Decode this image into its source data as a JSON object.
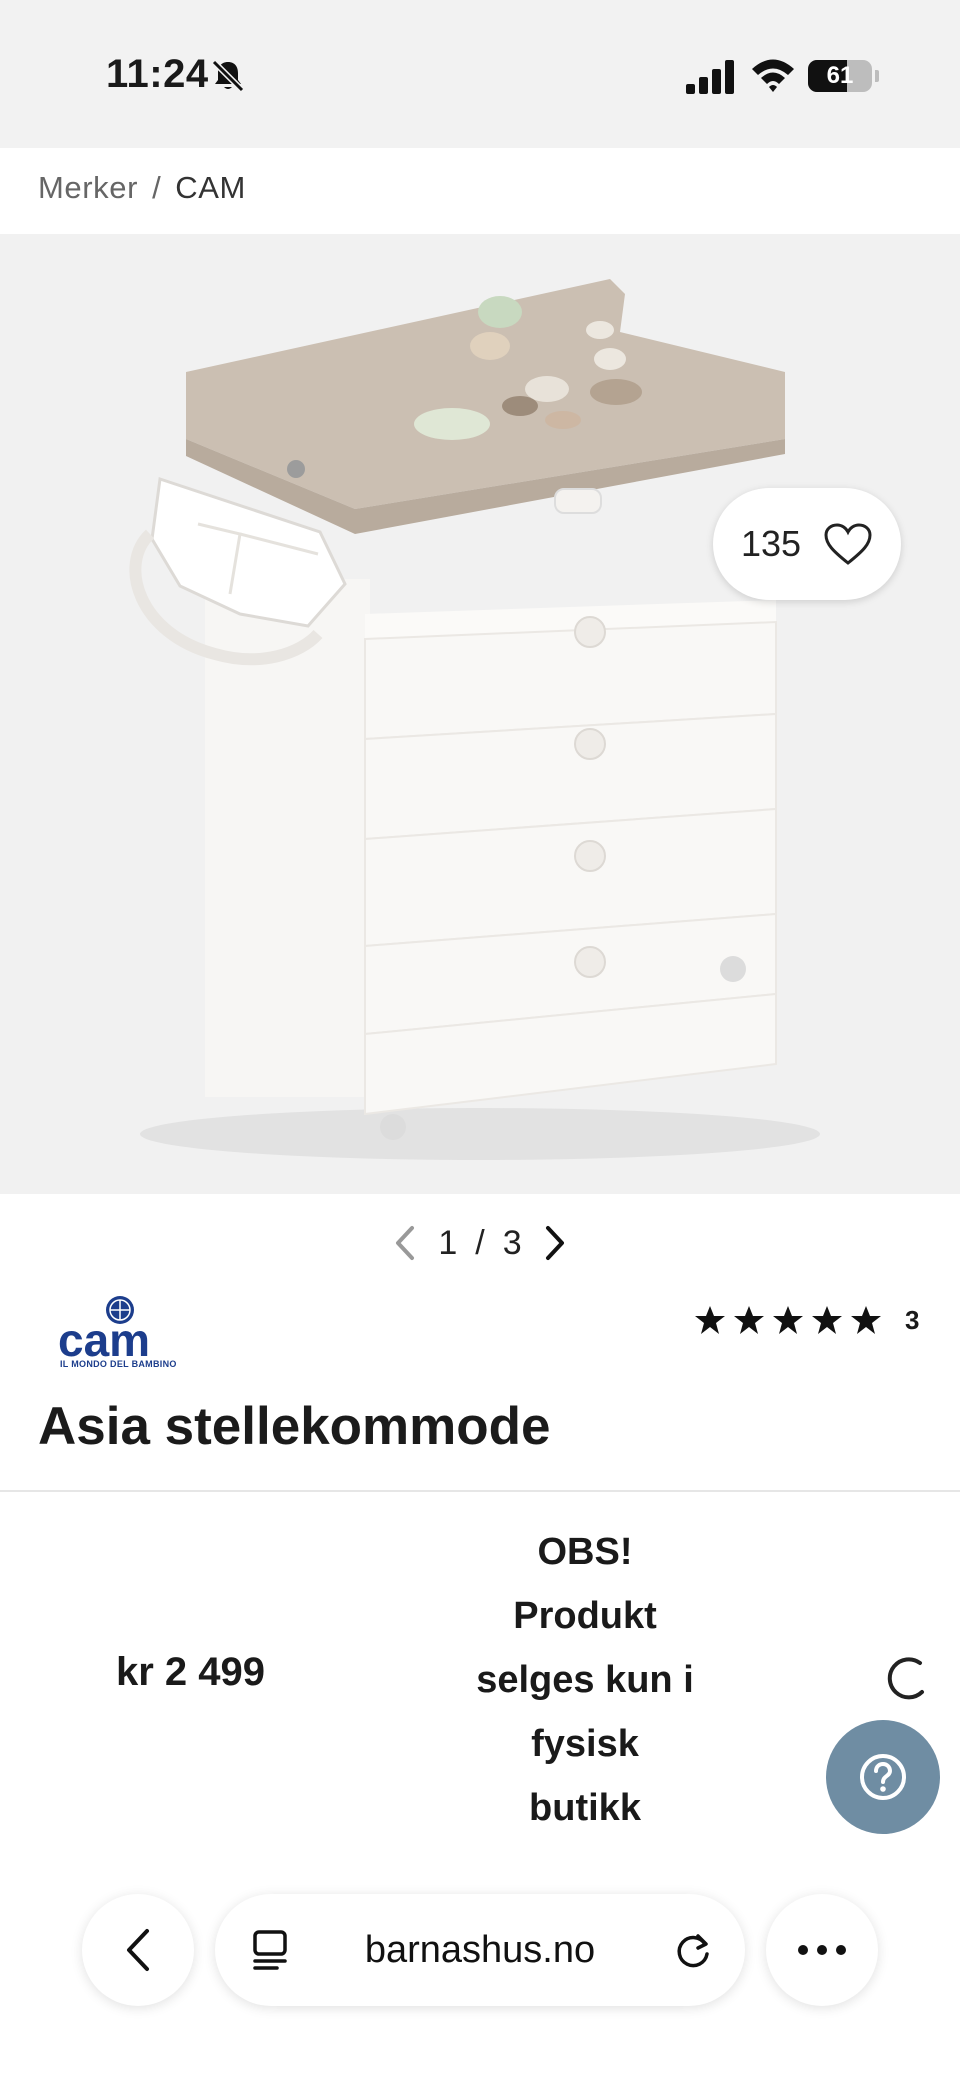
{
  "status_bar": {
    "time": "11:24",
    "battery": "61",
    "battery_level": 0.61,
    "icons": [
      "bell-slash-icon",
      "signal-icon",
      "wifi-icon",
      "battery-icon"
    ]
  },
  "breadcrumb": {
    "items": [
      {
        "label": "Merker"
      },
      {
        "label": "CAM"
      }
    ],
    "separator": "/"
  },
  "gallery": {
    "favorites_count": "135",
    "favorite_icon": "heart-icon",
    "pager_current": "1",
    "pager_separator": "/",
    "pager_total": "3",
    "prev_icon": "chevron-left-icon",
    "next_icon": "chevron-right-icon"
  },
  "product": {
    "brand_logo": "cam",
    "brand_tagline": "IL MONDO DEL BAMBINO",
    "rating_stars": 5,
    "review_count": "3",
    "title": "Asia stellekommode",
    "price": "kr 2 499",
    "notice_lines": [
      "OBS!",
      "Produkt",
      "selges kun i",
      "fysisk",
      "butikk"
    ]
  },
  "help_button": {
    "icon": "question-circle-icon",
    "color": "#6f8da3"
  },
  "browser": {
    "url": "barnashus.no",
    "icons": [
      "back-icon",
      "tabs-icon",
      "reload-icon",
      "more-icon"
    ]
  },
  "colors": {
    "brand_blue": "#1c3d8c",
    "text_primary": "#1a1a1a",
    "muted": "#666666",
    "image_bg": "#f1f1f1"
  }
}
